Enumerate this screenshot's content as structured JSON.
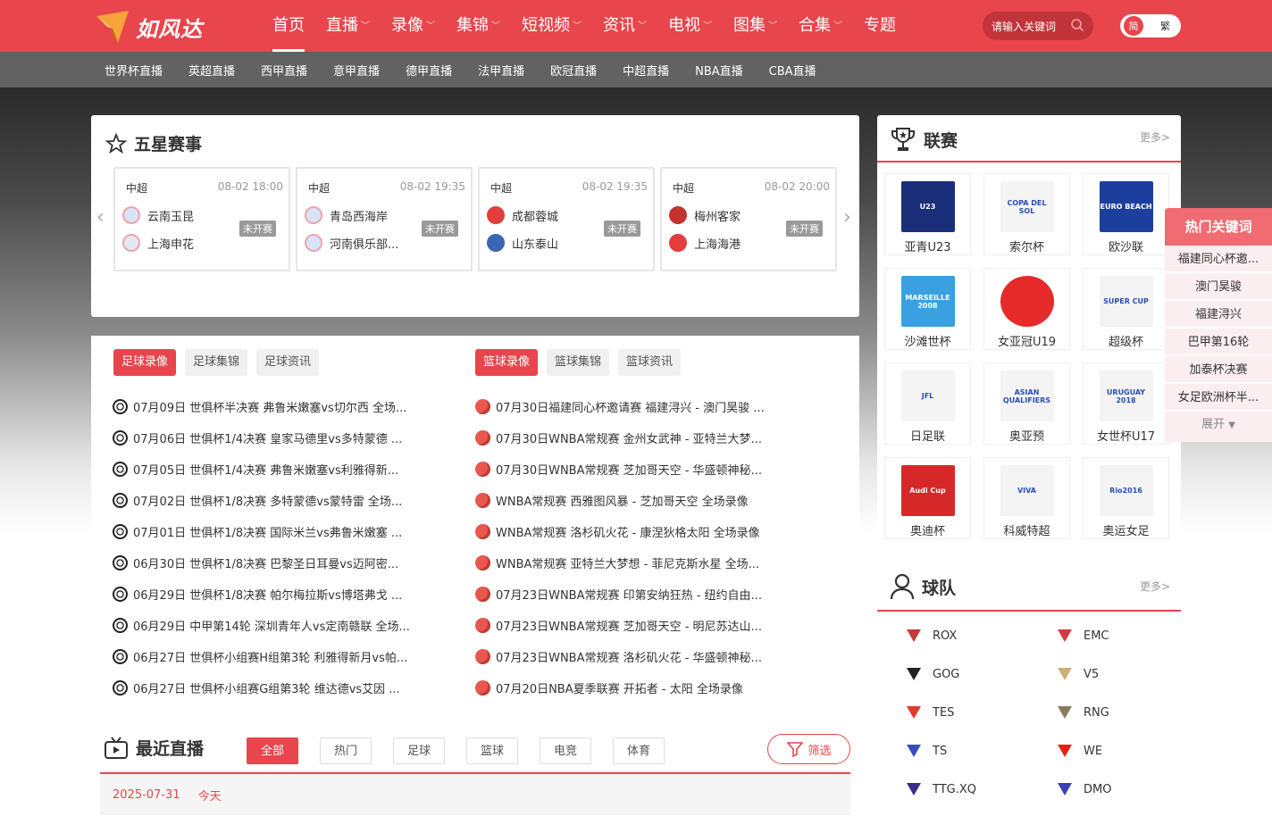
{
  "brand": {
    "name": "如风达",
    "color": "#e8454c"
  },
  "nav": {
    "items": [
      {
        "label": "首页",
        "active": true,
        "dropdown": false
      },
      {
        "label": "直播",
        "active": false,
        "dropdown": true
      },
      {
        "label": "录像",
        "active": false,
        "dropdown": true
      },
      {
        "label": "集锦",
        "active": false,
        "dropdown": true
      },
      {
        "label": "短视频",
        "active": false,
        "dropdown": true
      },
      {
        "label": "资讯",
        "active": false,
        "dropdown": true
      },
      {
        "label": "电视",
        "active": false,
        "dropdown": true
      },
      {
        "label": "图集",
        "active": false,
        "dropdown": true
      },
      {
        "label": "合集",
        "active": false,
        "dropdown": true
      },
      {
        "label": "专题",
        "active": false,
        "dropdown": false
      }
    ],
    "search_placeholder": "请输入关键词",
    "lang_on": "简",
    "lang_off": "繁"
  },
  "subnav": [
    "世界杯直播",
    "英超直播",
    "西甲直播",
    "意甲直播",
    "德甲直播",
    "法甲直播",
    "欧冠直播",
    "中超直播",
    "NBA直播",
    "CBA直播"
  ],
  "featured": {
    "title": "五星赛事",
    "matches": [
      {
        "league": "中超",
        "time": "08-02 18:00",
        "home": "云南玉昆",
        "away": "上海申花",
        "status": "未开赛"
      },
      {
        "league": "中超",
        "time": "08-02 19:35",
        "home": "青岛西海岸",
        "away": "河南俱乐部...",
        "status": "未开赛"
      },
      {
        "league": "中超",
        "time": "08-02 19:35",
        "home": "成都蓉城",
        "away": "山东泰山",
        "status": "未开赛"
      },
      {
        "league": "中超",
        "time": "08-02 20:00",
        "home": "梅州客家",
        "away": "上海海港",
        "status": "未开赛"
      }
    ]
  },
  "football": {
    "tabs": [
      "足球录像",
      "足球集锦",
      "足球资讯"
    ],
    "items": [
      "07月09日 世俱杯半决赛 弗鲁米嫩塞vs切尔西 全场...",
      "07月06日 世俱杯1/4决赛 皇家马德里vs多特蒙德 ...",
      "07月05日 世俱杯1/4决赛 弗鲁米嫩塞vs利雅得新...",
      "07月02日 世俱杯1/8决赛 多特蒙德vs蒙特雷 全场...",
      "07月01日 世俱杯1/8决赛 国际米兰vs弗鲁米嫩塞 ...",
      "06月30日 世俱杯1/8决赛 巴黎圣日耳曼vs迈阿密...",
      "06月29日 世俱杯1/8决赛 帕尔梅拉斯vs博塔弗戈 ...",
      "06月29日 中甲第14轮 深圳青年人vs定南赣联 全场...",
      "06月27日 世俱杯小组赛H组第3轮 利雅得新月vs帕...",
      "06月27日 世俱杯小组赛G组第3轮 维达德vs艾因 ..."
    ]
  },
  "basketball": {
    "tabs": [
      "篮球录像",
      "篮球集锦",
      "篮球资讯"
    ],
    "items": [
      "07月30日福建同心杯邀请赛 福建浔兴 - 澳门昊骏 ...",
      "07月30日WNBA常规赛 金州女武神 - 亚特兰大梦...",
      "07月30日WNBA常规赛 芝加哥天空 - 华盛顿神秘...",
      "WNBA常规赛 西雅图风暴 - 芝加哥天空 全场录像",
      "WNBA常规赛 洛杉矶火花 - 康涅狄格太阳 全场录像",
      "WNBA常规赛 亚特兰大梦想 - 菲尼克斯水星 全场...",
      "07月23日WNBA常规赛 印第安纳狂热 - 纽约自由...",
      "07月23日WNBA常规赛 芝加哥天空 - 明尼苏达山...",
      "07月23日WNBA常规赛 洛杉矶火花 - 华盛顿神秘...",
      "07月20日NBA夏季联赛 开拓者 - 太阳 全场录像"
    ]
  },
  "recent": {
    "title": "最近直播",
    "tabs": [
      "全部",
      "热门",
      "足球",
      "篮球",
      "电竞",
      "体育"
    ],
    "filter": "筛选",
    "date": "2025-07-31",
    "day": "今天"
  },
  "leagues": {
    "title": "联赛",
    "more": "更多>",
    "items": [
      {
        "name": "亚青U23",
        "badge": "U23"
      },
      {
        "name": "索尔杯",
        "badge": "COPA DEL SOL"
      },
      {
        "name": "欧沙联",
        "badge": "EURO BEACH"
      },
      {
        "name": "沙滩世杯",
        "badge": "MARSEILLE 2008"
      },
      {
        "name": "女亚冠U19",
        "badge": ""
      },
      {
        "name": "超级杯",
        "badge": "SUPER CUP"
      },
      {
        "name": "日足联",
        "badge": "JFL"
      },
      {
        "name": "奥亚预",
        "badge": "ASIAN QUALIFIERS"
      },
      {
        "name": "女世杯U17",
        "badge": "URUGUAY 2018"
      },
      {
        "name": "奥迪杯",
        "badge": "Audi Cup"
      },
      {
        "name": "科威特超",
        "badge": "VIVA"
      },
      {
        "name": "奥运女足",
        "badge": "Rio2016"
      }
    ]
  },
  "teams": {
    "title": "球队",
    "more": "更多>",
    "items": [
      "ROX",
      "EMC",
      "GOG",
      "V5",
      "TES",
      "RNG",
      "TS",
      "WE",
      "TTG.XQ",
      "DMO"
    ]
  },
  "hot_keywords": {
    "title": "热门关键词",
    "items": [
      "福建同心杯邀...",
      "澳门昊骏",
      "福建浔兴",
      "巴甲第16轮",
      "加泰杯决赛",
      "女足欧洲杯半..."
    ],
    "expand": "展开"
  }
}
